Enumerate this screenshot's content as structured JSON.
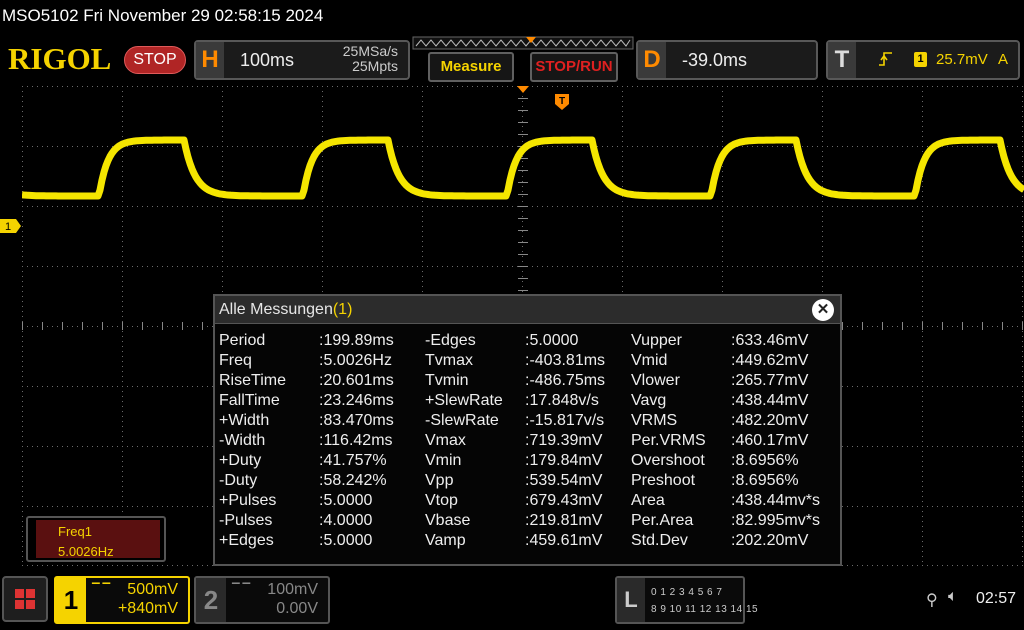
{
  "title_bar": {
    "text": "MSO5102  Fri November 29 02:58:15 2024"
  },
  "toolbar": {
    "logo": "RIGOL",
    "run_state": "STOP",
    "horizontal": {
      "letter": "H",
      "timebase": "100ms",
      "sample_rate": "25MSa/s",
      "memory_depth": "25Mpts"
    },
    "measure_label": "Measure",
    "stop_run_label": "STOP/RUN",
    "delay": {
      "letter": "D",
      "value": "-39.0ms"
    },
    "trigger": {
      "letter": "T",
      "slope_icon": "rising-edge-icon",
      "source": "1",
      "level": "25.7mV",
      "mode": "A"
    }
  },
  "waveform": {
    "channel_marker": "1",
    "trigger_marker": "T",
    "colors": {
      "ch1": "#f5e600",
      "grid": "#6a6a6a",
      "trigger": "#ff8a00"
    }
  },
  "measurements": {
    "dialog_title": "Alle Messungen",
    "dialog_title_channel": "(1)",
    "columns": [
      [
        {
          "name": "Period",
          "value": ":199.89ms"
        },
        {
          "name": "Freq",
          "value": ":5.0026Hz"
        },
        {
          "name": "RiseTime",
          "value": ":20.601ms"
        },
        {
          "name": "FallTime",
          "value": ":23.246ms"
        },
        {
          "name": "+Width",
          "value": ":83.470ms"
        },
        {
          "name": "-Width",
          "value": ":116.42ms"
        },
        {
          "name": "+Duty",
          "value": ":41.757%"
        },
        {
          "name": "-Duty",
          "value": ":58.242%"
        },
        {
          "name": "+Pulses",
          "value": ":5.0000"
        },
        {
          "name": "-Pulses",
          "value": ":4.0000"
        },
        {
          "name": "+Edges",
          "value": ":5.0000"
        }
      ],
      [
        {
          "name": "-Edges",
          "value": ":5.0000"
        },
        {
          "name": "Tvmax",
          "value": ":-403.81ms"
        },
        {
          "name": "Tvmin",
          "value": ":-486.75ms"
        },
        {
          "name": "+SlewRate",
          "value": ":17.848v/s"
        },
        {
          "name": "-SlewRate",
          "value": ":-15.817v/s"
        },
        {
          "name": "Vmax",
          "value": ":719.39mV"
        },
        {
          "name": "Vmin",
          "value": ":179.84mV"
        },
        {
          "name": "Vpp",
          "value": ":539.54mV"
        },
        {
          "name": "Vtop",
          "value": ":679.43mV"
        },
        {
          "name": "Vbase",
          "value": ":219.81mV"
        },
        {
          "name": "Vamp",
          "value": ":459.61mV"
        }
      ],
      [
        {
          "name": "Vupper",
          "value": ":633.46mV"
        },
        {
          "name": "Vmid",
          "value": ":449.62mV"
        },
        {
          "name": "Vlower",
          "value": ":265.77mV"
        },
        {
          "name": "Vavg",
          "value": ":438.44mV"
        },
        {
          "name": "VRMS",
          "value": ":482.20mV"
        },
        {
          "name": "Per.VRMS",
          "value": ":460.17mV"
        },
        {
          "name": "Overshoot",
          "value": ":8.6956%"
        },
        {
          "name": "Preshoot",
          "value": ":8.6956%"
        },
        {
          "name": "Area",
          "value": ":438.44mv*s"
        },
        {
          "name": "Per.Area",
          "value": ":82.995mv*s"
        },
        {
          "name": "Std.Dev",
          "value": ":202.20mV"
        }
      ]
    ]
  },
  "freq_box": {
    "label": "Freq1",
    "value": "5.0026Hz"
  },
  "bottom": {
    "ch1": {
      "number": "1",
      "scale": "500mV",
      "offset": "+840mV"
    },
    "ch2": {
      "number": "2",
      "scale": "100mV",
      "offset": "0.00V"
    },
    "la": {
      "letter": "L",
      "row1": "0 1 2 3  4 5 6 7",
      "row2": "8 9 10 11 12 13 14 15"
    },
    "clock": "02:57"
  }
}
